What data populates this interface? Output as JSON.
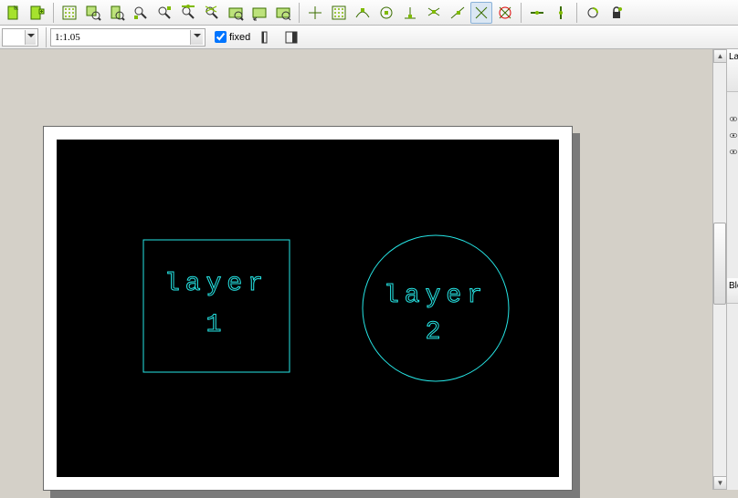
{
  "toolbar_top": {
    "buttons": [
      "file-new",
      "file-new-layer",
      "|",
      "grid-show",
      "zoom-selection",
      "zoom-page",
      "snap-free",
      "snap-endpoint",
      "snap-midpoint",
      "snap-intersection",
      "zoom-fit",
      "zoom-previous",
      "zoom-redraw",
      "|",
      "snap-grid-origin",
      "snap-grid",
      "snap-on-entity",
      "snap-center",
      "snap-perpendicular",
      "snap-tangent",
      "snap-nearest",
      "snap-cross",
      "snap-none",
      "|",
      "dim-horizontal",
      "dim-vertical",
      "|",
      "lock-angle",
      "lock-angle-2"
    ],
    "active": "snap-cross"
  },
  "toolbar_second": {
    "field1": "",
    "ratio": "1:1.05",
    "fixed_label": "fixed",
    "fixed_checked": true,
    "align_buttons": [
      "align-left",
      "align-right"
    ]
  },
  "right_panel": {
    "tab1": "La",
    "tab2": "Blo",
    "eyes": [
      "eye",
      "eye",
      "eye"
    ]
  },
  "drawing": {
    "layer1_line1": "layer",
    "layer1_line2": "1",
    "layer2_line1": "layer",
    "layer2_line2": "2",
    "stroke": "#26e6e6"
  }
}
